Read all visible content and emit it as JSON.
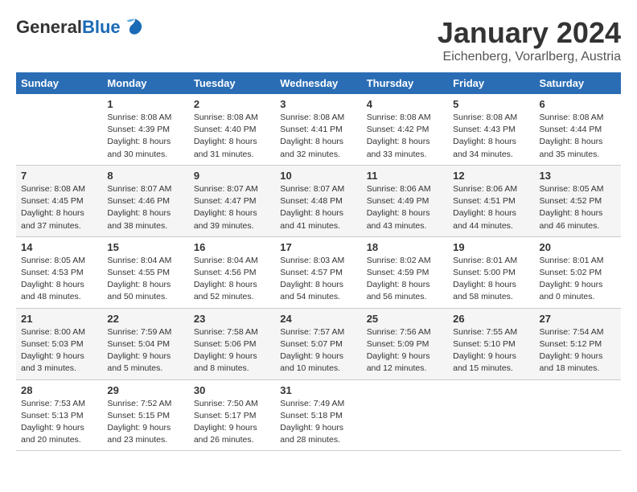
{
  "header": {
    "logo": {
      "general": "General",
      "blue": "Blue"
    },
    "title": "January 2024",
    "subtitle": "Eichenberg, Vorarlberg, Austria"
  },
  "calendar": {
    "days_of_week": [
      "Sunday",
      "Monday",
      "Tuesday",
      "Wednesday",
      "Thursday",
      "Friday",
      "Saturday"
    ],
    "weeks": [
      [
        {
          "day": "",
          "info": ""
        },
        {
          "day": "1",
          "info": "Sunrise: 8:08 AM\nSunset: 4:39 PM\nDaylight: 8 hours\nand 30 minutes."
        },
        {
          "day": "2",
          "info": "Sunrise: 8:08 AM\nSunset: 4:40 PM\nDaylight: 8 hours\nand 31 minutes."
        },
        {
          "day": "3",
          "info": "Sunrise: 8:08 AM\nSunset: 4:41 PM\nDaylight: 8 hours\nand 32 minutes."
        },
        {
          "day": "4",
          "info": "Sunrise: 8:08 AM\nSunset: 4:42 PM\nDaylight: 8 hours\nand 33 minutes."
        },
        {
          "day": "5",
          "info": "Sunrise: 8:08 AM\nSunset: 4:43 PM\nDaylight: 8 hours\nand 34 minutes."
        },
        {
          "day": "6",
          "info": "Sunrise: 8:08 AM\nSunset: 4:44 PM\nDaylight: 8 hours\nand 35 minutes."
        }
      ],
      [
        {
          "day": "7",
          "info": "Sunrise: 8:08 AM\nSunset: 4:45 PM\nDaylight: 8 hours\nand 37 minutes."
        },
        {
          "day": "8",
          "info": "Sunrise: 8:07 AM\nSunset: 4:46 PM\nDaylight: 8 hours\nand 38 minutes."
        },
        {
          "day": "9",
          "info": "Sunrise: 8:07 AM\nSunset: 4:47 PM\nDaylight: 8 hours\nand 39 minutes."
        },
        {
          "day": "10",
          "info": "Sunrise: 8:07 AM\nSunset: 4:48 PM\nDaylight: 8 hours\nand 41 minutes."
        },
        {
          "day": "11",
          "info": "Sunrise: 8:06 AM\nSunset: 4:49 PM\nDaylight: 8 hours\nand 43 minutes."
        },
        {
          "day": "12",
          "info": "Sunrise: 8:06 AM\nSunset: 4:51 PM\nDaylight: 8 hours\nand 44 minutes."
        },
        {
          "day": "13",
          "info": "Sunrise: 8:05 AM\nSunset: 4:52 PM\nDaylight: 8 hours\nand 46 minutes."
        }
      ],
      [
        {
          "day": "14",
          "info": "Sunrise: 8:05 AM\nSunset: 4:53 PM\nDaylight: 8 hours\nand 48 minutes."
        },
        {
          "day": "15",
          "info": "Sunrise: 8:04 AM\nSunset: 4:55 PM\nDaylight: 8 hours\nand 50 minutes."
        },
        {
          "day": "16",
          "info": "Sunrise: 8:04 AM\nSunset: 4:56 PM\nDaylight: 8 hours\nand 52 minutes."
        },
        {
          "day": "17",
          "info": "Sunrise: 8:03 AM\nSunset: 4:57 PM\nDaylight: 8 hours\nand 54 minutes."
        },
        {
          "day": "18",
          "info": "Sunrise: 8:02 AM\nSunset: 4:59 PM\nDaylight: 8 hours\nand 56 minutes."
        },
        {
          "day": "19",
          "info": "Sunrise: 8:01 AM\nSunset: 5:00 PM\nDaylight: 8 hours\nand 58 minutes."
        },
        {
          "day": "20",
          "info": "Sunrise: 8:01 AM\nSunset: 5:02 PM\nDaylight: 9 hours\nand 0 minutes."
        }
      ],
      [
        {
          "day": "21",
          "info": "Sunrise: 8:00 AM\nSunset: 5:03 PM\nDaylight: 9 hours\nand 3 minutes."
        },
        {
          "day": "22",
          "info": "Sunrise: 7:59 AM\nSunset: 5:04 PM\nDaylight: 9 hours\nand 5 minutes."
        },
        {
          "day": "23",
          "info": "Sunrise: 7:58 AM\nSunset: 5:06 PM\nDaylight: 9 hours\nand 8 minutes."
        },
        {
          "day": "24",
          "info": "Sunrise: 7:57 AM\nSunset: 5:07 PM\nDaylight: 9 hours\nand 10 minutes."
        },
        {
          "day": "25",
          "info": "Sunrise: 7:56 AM\nSunset: 5:09 PM\nDaylight: 9 hours\nand 12 minutes."
        },
        {
          "day": "26",
          "info": "Sunrise: 7:55 AM\nSunset: 5:10 PM\nDaylight: 9 hours\nand 15 minutes."
        },
        {
          "day": "27",
          "info": "Sunrise: 7:54 AM\nSunset: 5:12 PM\nDaylight: 9 hours\nand 18 minutes."
        }
      ],
      [
        {
          "day": "28",
          "info": "Sunrise: 7:53 AM\nSunset: 5:13 PM\nDaylight: 9 hours\nand 20 minutes."
        },
        {
          "day": "29",
          "info": "Sunrise: 7:52 AM\nSunset: 5:15 PM\nDaylight: 9 hours\nand 23 minutes."
        },
        {
          "day": "30",
          "info": "Sunrise: 7:50 AM\nSunset: 5:17 PM\nDaylight: 9 hours\nand 26 minutes."
        },
        {
          "day": "31",
          "info": "Sunrise: 7:49 AM\nSunset: 5:18 PM\nDaylight: 9 hours\nand 28 minutes."
        },
        {
          "day": "",
          "info": ""
        },
        {
          "day": "",
          "info": ""
        },
        {
          "day": "",
          "info": ""
        }
      ]
    ]
  }
}
